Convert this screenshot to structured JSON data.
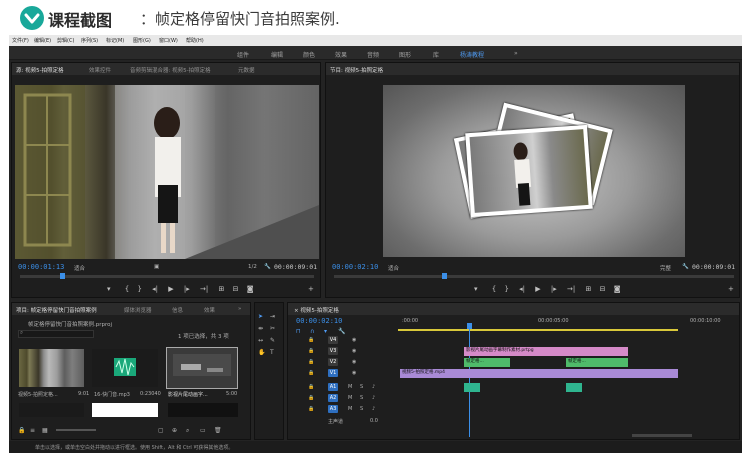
{
  "header": {
    "title": "课程截图",
    "subtitle": "：帧定格停留快门音拍照案例."
  },
  "menu": [
    "文件(F)",
    "编辑(E)",
    "剪辑(C)",
    "序列(S)",
    "标记(M)",
    "图形(G)",
    "窗口(W)",
    "帮助(H)"
  ],
  "workspaces": [
    {
      "label": "组件",
      "active": false
    },
    {
      "label": "编辑",
      "active": false
    },
    {
      "label": "颜色",
      "active": false
    },
    {
      "label": "效果",
      "active": false
    },
    {
      "label": "音频",
      "active": false
    },
    {
      "label": "图形",
      "active": false
    },
    {
      "label": "库",
      "active": false
    },
    {
      "label": "杨涛教程",
      "active": true
    }
  ],
  "workspace_more": "»",
  "source_monitor": {
    "tabs": [
      "源: 视频5-拍照定格",
      "效果控件",
      "音频剪辑混合器: 视频5-拍照定格",
      "元数据"
    ],
    "timecode": "00:00:01:13",
    "fit": "适合",
    "scale": "1/2",
    "duration": "00:00:09:01"
  },
  "program_monitor": {
    "tab": "节目: 视频5-拍照定格",
    "timecode": "00:00:02:10",
    "fit": "适合",
    "quality": "完整",
    "duration": "00:00:09:01"
  },
  "project_panel": {
    "tabs": [
      "项目: 帧定格停留快门音拍照案例",
      "媒体浏览器",
      "信息",
      "效果"
    ],
    "project_name": "帧定格停留快门音拍照案例.prproj",
    "selection_info": "1 项已选择，共 3 项",
    "items": [
      {
        "name": "视频5-拍照定格...",
        "duration": "9:01"
      },
      {
        "name": "16-快门音.mp3",
        "duration": "0:23040"
      },
      {
        "name": "影视片尾动画字...",
        "duration": "5:00"
      }
    ]
  },
  "timeline": {
    "tab": "视频5-拍照定格",
    "timecode": "00:00:02:10",
    "ruler": [
      ":00:00",
      "00:00:05:00",
      "00:00:10:00"
    ],
    "tracks": [
      "V4",
      "V3",
      "V2",
      "V1",
      "A1",
      "A2",
      "A3"
    ],
    "master": "主声道",
    "master_value": "0.0",
    "clips": {
      "v3": "影视片尾动画字幕制作素材.prtpg",
      "v2_a": "帧定格...",
      "v2_b": "帧定格...",
      "v1": "视频5-拍照定格.mp4"
    }
  },
  "status_bar": "单击以选择，或单击空白处并拖动以进行框选。使用 Shift，Alt 和 Ctrl 可获得其他选项。",
  "colors": {
    "accent": "#3b8fe8",
    "header_icon": "#19a89a",
    "clip_pink": "#d58ac8",
    "clip_green": "#4fbb6a",
    "clip_violet": "#a98ad6",
    "audio_clip": "#2fb58f"
  }
}
